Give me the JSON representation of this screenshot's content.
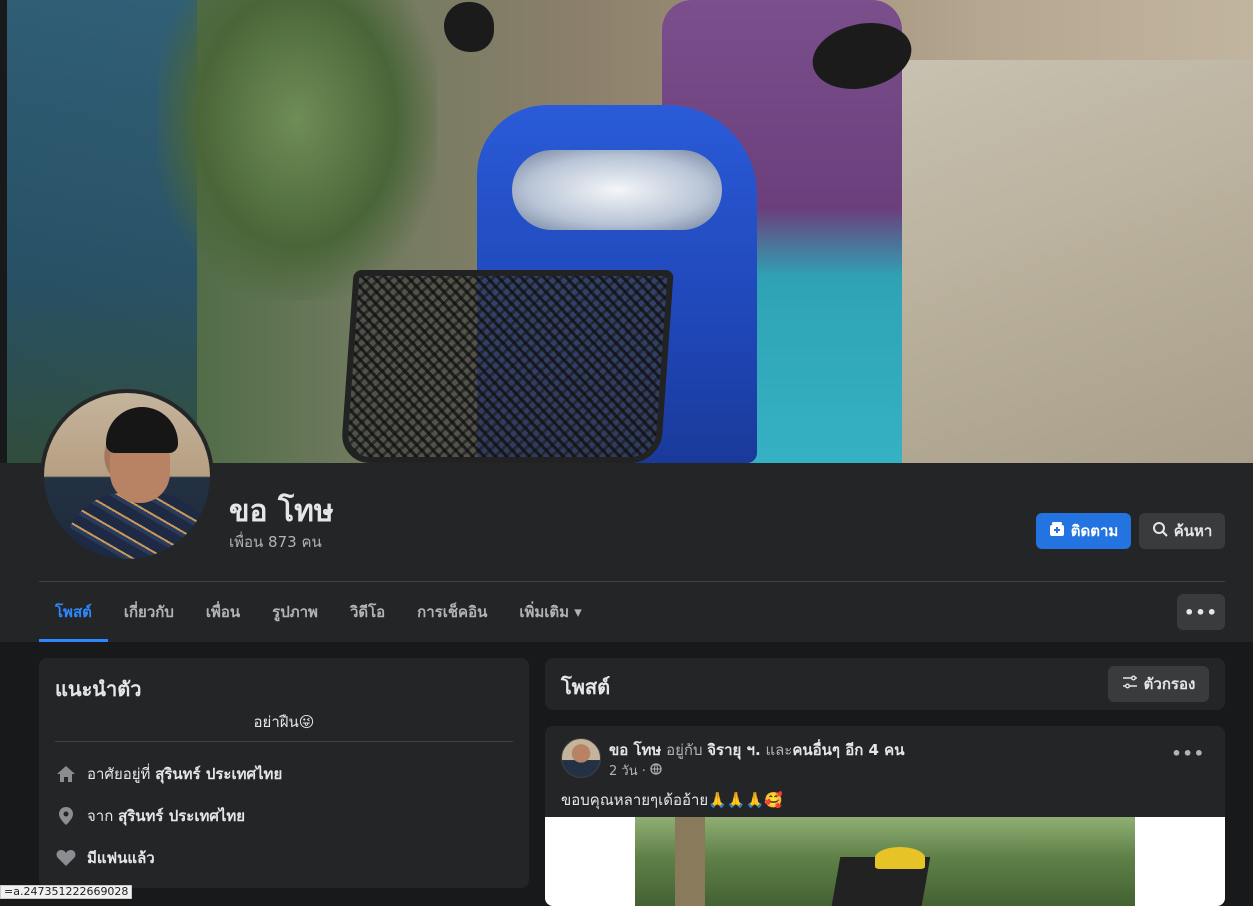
{
  "profile": {
    "name": "ขอ โทษ",
    "friends": "เพื่อน 873 คน",
    "follow_label": "ติดตาม",
    "search_label": "ค้นหา"
  },
  "tabs": [
    {
      "label": "โพสต์",
      "active": true
    },
    {
      "label": "เกี่ยวกับ"
    },
    {
      "label": "เพื่อน"
    },
    {
      "label": "รูปภาพ"
    },
    {
      "label": "วิดีโอ"
    },
    {
      "label": "การเช็คอิน"
    },
    {
      "label": "เพิ่มเติม ▾"
    }
  ],
  "more_label": "•••",
  "intro": {
    "title": "แนะนำตัว",
    "bio": "อย่าฝืน😜",
    "lives_prefix": "อาศัยอยู่ที่ ",
    "lives_value": "สุรินทร์ ประเทศไทย",
    "from_prefix": "จาก ",
    "from_value": "สุรินทร์ ประเทศไทย",
    "relationship": "มีแฟนแล้ว"
  },
  "posts": {
    "title": "โพสต์",
    "filter_label": "ตัวกรอง"
  },
  "post": {
    "author": "ขอ โทษ",
    "with_text": " อยู่กับ ",
    "tagged": "จิรายุ ฯ.",
    "and_text": " และ",
    "others": "คนอื่นๆ อีก 4 คน",
    "time": "2 วัน ·",
    "privacy_icon": "globe-icon",
    "text": "ขอบคุณหลายๆเด้ออ้าย🙏🙏🙏🥰",
    "dots": "•••"
  },
  "status_url": "=a.247351222669028"
}
